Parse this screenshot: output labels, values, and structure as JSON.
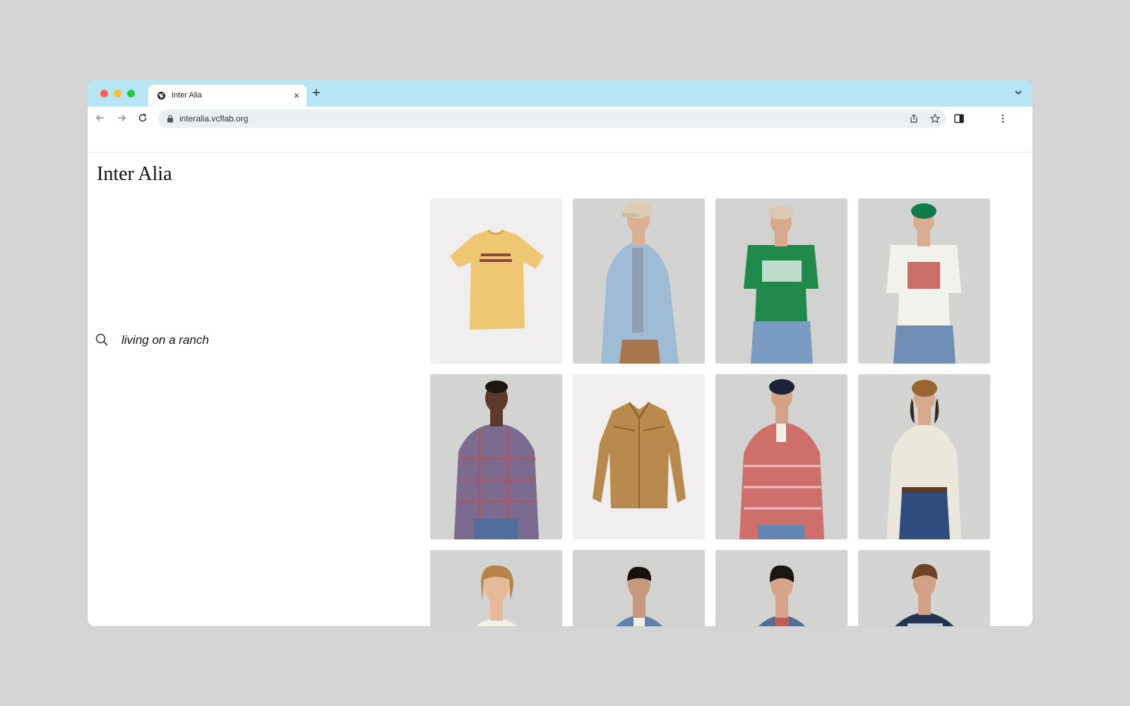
{
  "browser": {
    "tab_title": "Inter Alia",
    "url": "interalia.vcflab.org",
    "frame_color": "#b8e6f4",
    "page_background": "#d5d5d5"
  },
  "page": {
    "title": "Inter Alia",
    "search_query": "living on a ranch"
  },
  "products": [
    {
      "image": "yellow graphic t-shirt flat lay",
      "tile_bg": "#f0efed"
    },
    {
      "image": "model in light blue oxford shirt and khaki cap",
      "tile_bg": "#d3d3d1"
    },
    {
      "image": "model in green graphic t-shirt and khaki cap",
      "tile_bg": "#d2d2d0"
    },
    {
      "image": "model in white graphic t-shirt and green cap",
      "tile_bg": "#d4d4d2"
    },
    {
      "image": "model in plaid button-down shirt",
      "tile_bg": "#d3d3d1"
    },
    {
      "image": "tan suede western shirt flat lay",
      "tile_bg": "#f0efed"
    },
    {
      "image": "model in red gingham western shirt and navy cap",
      "tile_bg": "#d2d2d0"
    },
    {
      "image": "model in cream western shirt and brown cap",
      "tile_bg": "#d4d4d2"
    },
    {
      "image": "model in cream cable-knit sweater",
      "tile_bg": "#d3d3d1"
    },
    {
      "image": "model in denim trucker jacket",
      "tile_bg": "#d2d2d0"
    },
    {
      "image": "model in denim jacket over red shirt",
      "tile_bg": "#d3d3d1"
    },
    {
      "image": "model in navy Polo graphic t-shirt",
      "tile_bg": "#d4d4d2"
    }
  ]
}
